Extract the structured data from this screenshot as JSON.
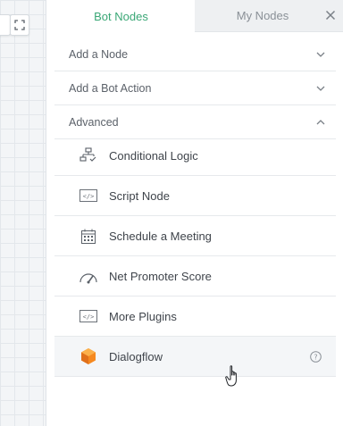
{
  "tabs": [
    {
      "label": "Bot Nodes",
      "active": true
    },
    {
      "label": "My Nodes",
      "active": false
    }
  ],
  "sections": [
    {
      "label": "Add a Node",
      "expanded": false
    },
    {
      "label": "Add a Bot Action",
      "expanded": false
    },
    {
      "label": "Advanced",
      "expanded": true
    }
  ],
  "advanced_items": [
    {
      "label": "Conditional Logic",
      "icon": "flowchart-icon"
    },
    {
      "label": "Script Node",
      "icon": "code-icon"
    },
    {
      "label": "Schedule a Meeting",
      "icon": "calendar-icon"
    },
    {
      "label": "Net Promoter Score",
      "icon": "gauge-icon"
    },
    {
      "label": "More Plugins",
      "icon": "code-icon"
    },
    {
      "label": "Dialogflow",
      "icon": "dialogflow-icon",
      "help_icon": "help-circle-icon"
    }
  ],
  "colors": {
    "active_tab": "#3aa776",
    "dialogflow_orange": "#f6891f",
    "canvas_bg": "#f3f5f7"
  }
}
